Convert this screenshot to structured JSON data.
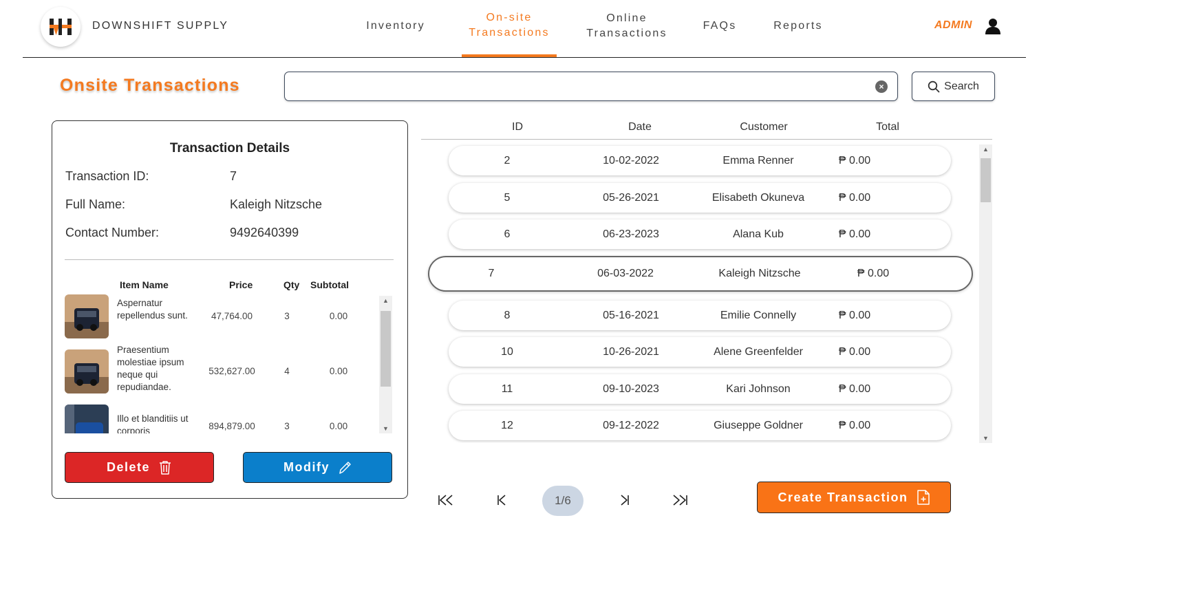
{
  "header": {
    "brand": "DOWNSHIFT SUPPLY",
    "nav": [
      {
        "label": "Inventory"
      },
      {
        "label": "On-site Transactions",
        "line1": "On-site",
        "line2": "Transactions",
        "active": true
      },
      {
        "label": "Online Transactions",
        "line1": "Online",
        "line2": "Transactions"
      },
      {
        "label": "FAQs"
      },
      {
        "label": "Reports"
      }
    ],
    "admin_label": "ADMIN",
    "user_icon": "user-icon"
  },
  "page": {
    "title": "Onsite Transactions",
    "search": {
      "value": "",
      "placeholder": "",
      "button_label": "Search"
    }
  },
  "details": {
    "title": "Transaction Details",
    "fields": [
      {
        "label": "Transaction ID:",
        "value": "7"
      },
      {
        "label": "Full Name:",
        "value": "Kaleigh Nitzsche"
      },
      {
        "label": "Contact Number:",
        "value": "9492640399"
      }
    ],
    "items_columns": [
      "Item Name",
      "Price",
      "Qty",
      "Subtotal"
    ],
    "items": [
      {
        "name": "Aspernatur repellendus sunt.",
        "price": "47,764.00",
        "qty": "3",
        "subtotal": "0.00"
      },
      {
        "name": "Praesentium molestiae ipsum neque qui repudiandae.",
        "price": "532,627.00",
        "qty": "4",
        "subtotal": "0.00"
      },
      {
        "name": "Illo et blanditiis ut corporis",
        "price": "894,879.00",
        "qty": "3",
        "subtotal": "0.00"
      }
    ],
    "delete_label": "Delete",
    "modify_label": "Modify"
  },
  "table": {
    "columns": [
      "ID",
      "Date",
      "Customer",
      "Total"
    ],
    "rows": [
      {
        "id": "2",
        "date": "10-02-2022",
        "customer": "Emma Renner",
        "total": "₱ 0.00"
      },
      {
        "id": "5",
        "date": "05-26-2021",
        "customer": "Elisabeth Okuneva",
        "total": "₱ 0.00"
      },
      {
        "id": "6",
        "date": "06-23-2023",
        "customer": "Alana Kub",
        "total": "₱ 0.00"
      },
      {
        "id": "7",
        "date": "06-03-2022",
        "customer": "Kaleigh Nitzsche",
        "total": "₱ 0.00",
        "selected": true
      },
      {
        "id": "8",
        "date": "05-16-2021",
        "customer": "Emilie Connelly",
        "total": "₱ 0.00"
      },
      {
        "id": "10",
        "date": "10-26-2021",
        "customer": "Alene Greenfelder",
        "total": "₱ 0.00"
      },
      {
        "id": "11",
        "date": "09-10-2023",
        "customer": "Kari Johnson",
        "total": "₱ 0.00"
      },
      {
        "id": "12",
        "date": "09-12-2022",
        "customer": "Giuseppe Goldner",
        "total": "₱ 0.00"
      }
    ]
  },
  "pagination": {
    "indicator": "1/6"
  },
  "create_label": "Create Transaction",
  "colors": {
    "accent": "#f47a20",
    "delete": "#dc2626",
    "modify": "#0b7fcb",
    "create": "#f97316",
    "page_indicator_bg": "#ccd6e3"
  }
}
